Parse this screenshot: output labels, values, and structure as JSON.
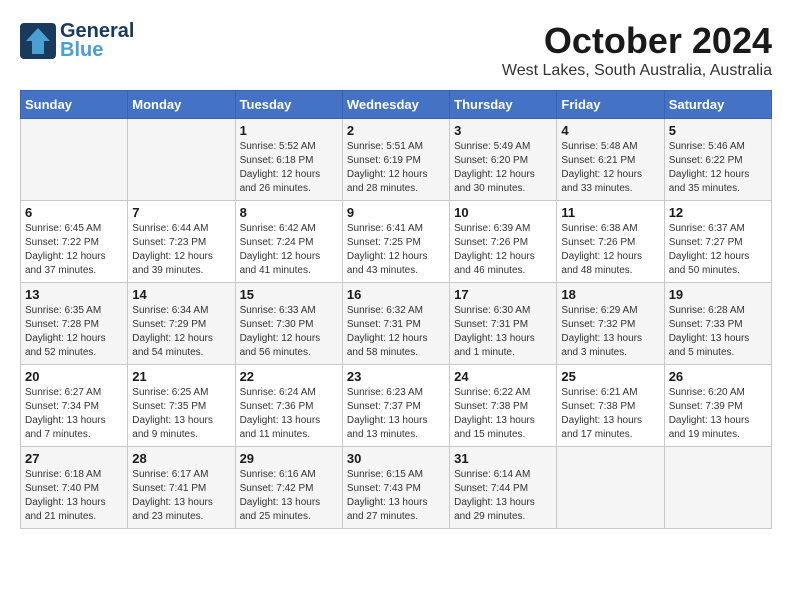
{
  "header": {
    "logo_line1": "General",
    "logo_line2": "Blue",
    "month": "October 2024",
    "location": "West Lakes, South Australia, Australia"
  },
  "days_of_week": [
    "Sunday",
    "Monday",
    "Tuesday",
    "Wednesday",
    "Thursday",
    "Friday",
    "Saturday"
  ],
  "weeks": [
    [
      {
        "day": "",
        "sunrise": "",
        "sunset": "",
        "daylight": ""
      },
      {
        "day": "",
        "sunrise": "",
        "sunset": "",
        "daylight": ""
      },
      {
        "day": "1",
        "sunrise": "Sunrise: 5:52 AM",
        "sunset": "Sunset: 6:18 PM",
        "daylight": "Daylight: 12 hours and 26 minutes."
      },
      {
        "day": "2",
        "sunrise": "Sunrise: 5:51 AM",
        "sunset": "Sunset: 6:19 PM",
        "daylight": "Daylight: 12 hours and 28 minutes."
      },
      {
        "day": "3",
        "sunrise": "Sunrise: 5:49 AM",
        "sunset": "Sunset: 6:20 PM",
        "daylight": "Daylight: 12 hours and 30 minutes."
      },
      {
        "day": "4",
        "sunrise": "Sunrise: 5:48 AM",
        "sunset": "Sunset: 6:21 PM",
        "daylight": "Daylight: 12 hours and 33 minutes."
      },
      {
        "day": "5",
        "sunrise": "Sunrise: 5:46 AM",
        "sunset": "Sunset: 6:22 PM",
        "daylight": "Daylight: 12 hours and 35 minutes."
      }
    ],
    [
      {
        "day": "6",
        "sunrise": "Sunrise: 6:45 AM",
        "sunset": "Sunset: 7:22 PM",
        "daylight": "Daylight: 12 hours and 37 minutes."
      },
      {
        "day": "7",
        "sunrise": "Sunrise: 6:44 AM",
        "sunset": "Sunset: 7:23 PM",
        "daylight": "Daylight: 12 hours and 39 minutes."
      },
      {
        "day": "8",
        "sunrise": "Sunrise: 6:42 AM",
        "sunset": "Sunset: 7:24 PM",
        "daylight": "Daylight: 12 hours and 41 minutes."
      },
      {
        "day": "9",
        "sunrise": "Sunrise: 6:41 AM",
        "sunset": "Sunset: 7:25 PM",
        "daylight": "Daylight: 12 hours and 43 minutes."
      },
      {
        "day": "10",
        "sunrise": "Sunrise: 6:39 AM",
        "sunset": "Sunset: 7:26 PM",
        "daylight": "Daylight: 12 hours and 46 minutes."
      },
      {
        "day": "11",
        "sunrise": "Sunrise: 6:38 AM",
        "sunset": "Sunset: 7:26 PM",
        "daylight": "Daylight: 12 hours and 48 minutes."
      },
      {
        "day": "12",
        "sunrise": "Sunrise: 6:37 AM",
        "sunset": "Sunset: 7:27 PM",
        "daylight": "Daylight: 12 hours and 50 minutes."
      }
    ],
    [
      {
        "day": "13",
        "sunrise": "Sunrise: 6:35 AM",
        "sunset": "Sunset: 7:28 PM",
        "daylight": "Daylight: 12 hours and 52 minutes."
      },
      {
        "day": "14",
        "sunrise": "Sunrise: 6:34 AM",
        "sunset": "Sunset: 7:29 PM",
        "daylight": "Daylight: 12 hours and 54 minutes."
      },
      {
        "day": "15",
        "sunrise": "Sunrise: 6:33 AM",
        "sunset": "Sunset: 7:30 PM",
        "daylight": "Daylight: 12 hours and 56 minutes."
      },
      {
        "day": "16",
        "sunrise": "Sunrise: 6:32 AM",
        "sunset": "Sunset: 7:31 PM",
        "daylight": "Daylight: 12 hours and 58 minutes."
      },
      {
        "day": "17",
        "sunrise": "Sunrise: 6:30 AM",
        "sunset": "Sunset: 7:31 PM",
        "daylight": "Daylight: 13 hours and 1 minute."
      },
      {
        "day": "18",
        "sunrise": "Sunrise: 6:29 AM",
        "sunset": "Sunset: 7:32 PM",
        "daylight": "Daylight: 13 hours and 3 minutes."
      },
      {
        "day": "19",
        "sunrise": "Sunrise: 6:28 AM",
        "sunset": "Sunset: 7:33 PM",
        "daylight": "Daylight: 13 hours and 5 minutes."
      }
    ],
    [
      {
        "day": "20",
        "sunrise": "Sunrise: 6:27 AM",
        "sunset": "Sunset: 7:34 PM",
        "daylight": "Daylight: 13 hours and 7 minutes."
      },
      {
        "day": "21",
        "sunrise": "Sunrise: 6:25 AM",
        "sunset": "Sunset: 7:35 PM",
        "daylight": "Daylight: 13 hours and 9 minutes."
      },
      {
        "day": "22",
        "sunrise": "Sunrise: 6:24 AM",
        "sunset": "Sunset: 7:36 PM",
        "daylight": "Daylight: 13 hours and 11 minutes."
      },
      {
        "day": "23",
        "sunrise": "Sunrise: 6:23 AM",
        "sunset": "Sunset: 7:37 PM",
        "daylight": "Daylight: 13 hours and 13 minutes."
      },
      {
        "day": "24",
        "sunrise": "Sunrise: 6:22 AM",
        "sunset": "Sunset: 7:38 PM",
        "daylight": "Daylight: 13 hours and 15 minutes."
      },
      {
        "day": "25",
        "sunrise": "Sunrise: 6:21 AM",
        "sunset": "Sunset: 7:38 PM",
        "daylight": "Daylight: 13 hours and 17 minutes."
      },
      {
        "day": "26",
        "sunrise": "Sunrise: 6:20 AM",
        "sunset": "Sunset: 7:39 PM",
        "daylight": "Daylight: 13 hours and 19 minutes."
      }
    ],
    [
      {
        "day": "27",
        "sunrise": "Sunrise: 6:18 AM",
        "sunset": "Sunset: 7:40 PM",
        "daylight": "Daylight: 13 hours and 21 minutes."
      },
      {
        "day": "28",
        "sunrise": "Sunrise: 6:17 AM",
        "sunset": "Sunset: 7:41 PM",
        "daylight": "Daylight: 13 hours and 23 minutes."
      },
      {
        "day": "29",
        "sunrise": "Sunrise: 6:16 AM",
        "sunset": "Sunset: 7:42 PM",
        "daylight": "Daylight: 13 hours and 25 minutes."
      },
      {
        "day": "30",
        "sunrise": "Sunrise: 6:15 AM",
        "sunset": "Sunset: 7:43 PM",
        "daylight": "Daylight: 13 hours and 27 minutes."
      },
      {
        "day": "31",
        "sunrise": "Sunrise: 6:14 AM",
        "sunset": "Sunset: 7:44 PM",
        "daylight": "Daylight: 13 hours and 29 minutes."
      },
      {
        "day": "",
        "sunrise": "",
        "sunset": "",
        "daylight": ""
      },
      {
        "day": "",
        "sunrise": "",
        "sunset": "",
        "daylight": ""
      }
    ]
  ]
}
